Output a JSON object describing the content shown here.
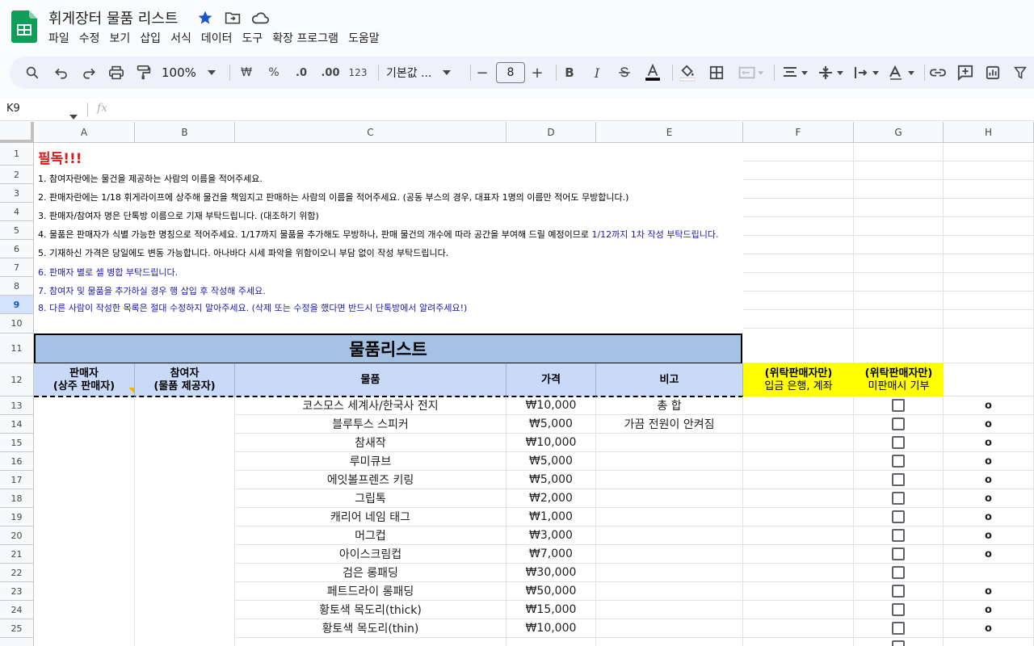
{
  "doc": {
    "title": "휘게장터 물품 리스트"
  },
  "menu": [
    "파일",
    "수정",
    "보기",
    "삽입",
    "서식",
    "데이터",
    "도구",
    "확장 프로그램",
    "도움말"
  ],
  "toolbar": {
    "zoom": "100%",
    "currency": "₩",
    "percent": "%",
    "dec_decrease": ".0",
    "dec_increase": ".00",
    "number_format": "123",
    "font": "기본값 ...",
    "font_size": "8",
    "minus": "−",
    "plus": "+",
    "bold": "B",
    "italic": "I"
  },
  "formula_bar": {
    "cell_ref": "K9",
    "fx": "fx"
  },
  "columns": [
    "A",
    "B",
    "C",
    "D",
    "E",
    "F",
    "G",
    "H"
  ],
  "rows": [
    "1",
    "2",
    "3",
    "4",
    "5",
    "6",
    "7",
    "8",
    "9",
    "10",
    "11",
    "12",
    "13",
    "14",
    "15",
    "16",
    "17",
    "18",
    "19",
    "20",
    "21",
    "22",
    "23",
    "24",
    "25"
  ],
  "active_row": "9",
  "notes": {
    "must_read": "필독!!!",
    "lines": [
      "1. 참여자란에는 물건을 제공하는 사람의 이름을 적어주세요.",
      "2. 판매자란에는 1/18 휘게라이프에 상주해 물건을 책임지고 판매하는 사람의 이름을 적어주세요. (공동 부스의 경우, 대표자 1명의 이름만 적어도 무방합니다.)",
      "3. 판매자/참여자 명은 단톡방 이름으로 기재 부탁드립니다. (대조하기 위함)",
      "4. 물품은 판매자가 식별 가능한 명칭으로 적어주세요. 1/17까지 물품을 추가해도 무방하나, 판매 물건의 개수에 따라 공간을 부여해 드릴 예정이므로",
      "5. 기재하신 가격은 당일에도 변동 가능합니다. 아나바다 시세 파악을 위함이오니 부담 없이 작성 부탁드립니다.",
      "6. 판매자 별로 셀 병합 부탁드립니다.",
      "7. 참여자 및 물품을 추가하실 경우 행 삽입 후 작성해 주세요.",
      "8. 다른 사람이 작성한 목록은 절대 수정하지 말아주세요. (삭제 또는 수정을 했다면 반드시 단톡방에서 알려주세요!)"
    ],
    "line4_blue": "1/12까지 1차 작성 부탁드립니다."
  },
  "table": {
    "title": "물품리스트",
    "headers": {
      "seller_line1": "판매자",
      "seller_line2": "(상주 판매자)",
      "participant_line1": "참여자",
      "participant_line2": "(물품 제공자)",
      "item": "물품",
      "price": "가격",
      "note": "비고",
      "bank_line1": "(위탁판매자만)",
      "bank_line2": "입금 은행, 계좌",
      "donate_line1": "(위탁판매자만)",
      "donate_line2": "미판매시 기부"
    },
    "rows": [
      {
        "item": "코스모스 세계사/한국사 전지",
        "price": "₩10,000",
        "note": "총 합",
        "donate": "o"
      },
      {
        "item": "블루투스 스피커",
        "price": "₩5,000",
        "note": "가끔 전원이 안켜짐",
        "donate": "o"
      },
      {
        "item": "참새작",
        "price": "₩10,000",
        "note": "",
        "donate": "o"
      },
      {
        "item": "루미큐브",
        "price": "₩5,000",
        "note": "",
        "donate": "o"
      },
      {
        "item": "에잇볼프렌즈 키링",
        "price": "₩5,000",
        "note": "",
        "donate": "o"
      },
      {
        "item": "그립톡",
        "price": "₩2,000",
        "note": "",
        "donate": "o"
      },
      {
        "item": "캐리어 네임 태그",
        "price": "₩1,000",
        "note": "",
        "donate": "o"
      },
      {
        "item": "머그컵",
        "price": "₩3,000",
        "note": "",
        "donate": "o"
      },
      {
        "item": "아이스크림컵",
        "price": "₩7,000",
        "note": "",
        "donate": "o"
      },
      {
        "item": "검은 롱패딩",
        "price": "₩30,000",
        "note": "",
        "donate": ""
      },
      {
        "item": "페트드라이 롱패딩",
        "price": "₩50,000",
        "note": "",
        "donate": "o"
      },
      {
        "item": "황토색 목도리(thick)",
        "price": "₩15,000",
        "note": "",
        "donate": "o"
      },
      {
        "item": "황토색 목도리(thin)",
        "price": "₩10,000",
        "note": "",
        "donate": "o"
      }
    ]
  }
}
